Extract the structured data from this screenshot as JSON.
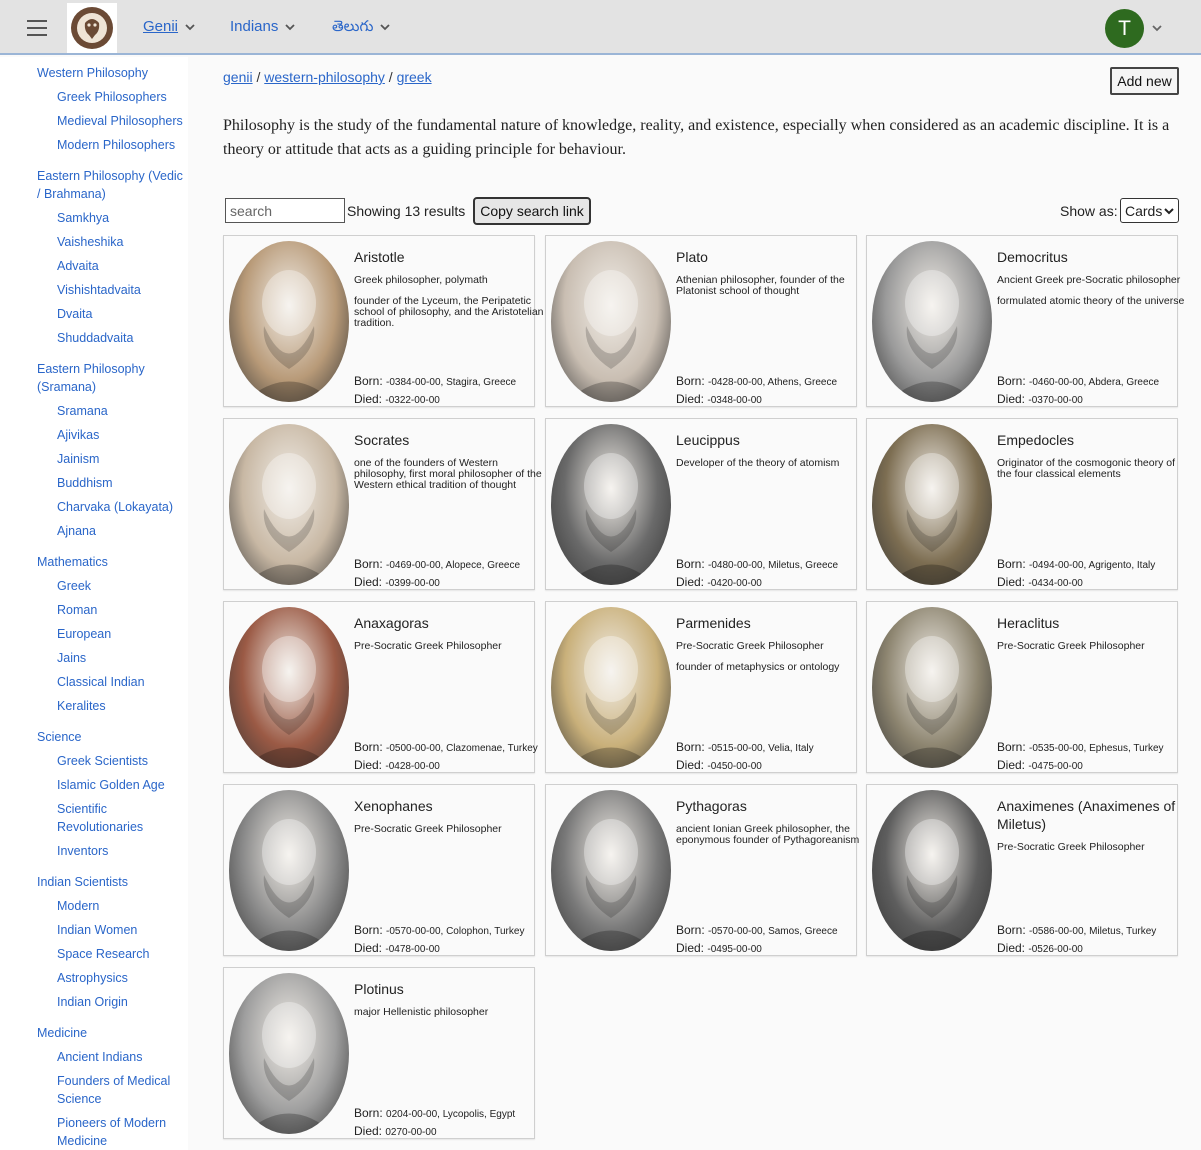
{
  "header": {
    "menus": [
      {
        "label": "Genii"
      },
      {
        "label": "Indians"
      },
      {
        "label": "తెలుగు"
      }
    ],
    "user_initial": "T"
  },
  "sidebar": {
    "groups": [
      {
        "label": "Western Philosophy",
        "items": [
          "Greek Philosophers",
          "Medieval Philosophers",
          "Modern Philosophers"
        ]
      },
      {
        "label": "Eastern Philosophy (Vedic / Brahmana)",
        "items": [
          "Samkhya",
          "Vaisheshika",
          "Advaita",
          "Vishishtadvaita",
          "Dvaita",
          "Shuddadvaita"
        ]
      },
      {
        "label": "Eastern Philosophy (Sramana)",
        "items": [
          "Sramana",
          "Ajivikas",
          "Jainism",
          "Buddhism",
          "Charvaka (Lokayata)",
          "Ajnana"
        ]
      },
      {
        "label": "Mathematics",
        "items": [
          "Greek",
          "Roman",
          "European",
          "Jains",
          "Classical Indian",
          "Keralites"
        ]
      },
      {
        "label": "Science",
        "items": [
          "Greek Scientists",
          "Islamic Golden Age",
          "Scientific Revolutionaries",
          "Inventors"
        ]
      },
      {
        "label": "Indian Scientists",
        "items": [
          "Modern",
          "Indian Women",
          "Space Research",
          "Astrophysics",
          "Indian Origin"
        ]
      },
      {
        "label": "Medicine",
        "items": [
          "Ancient Indians",
          "Founders of Medical Science",
          "Pioneers of Modern Medicine"
        ]
      }
    ]
  },
  "breadcrumb": {
    "root": "genii",
    "sep": "/",
    "parent": "western-philosophy",
    "current": "greek"
  },
  "add_new_label": "Add new",
  "description": "Philosophy is the study of the fundamental nature of knowledge, reality, and existence, especially when considered as an academic discipline. It is a theory or attitude that acts as a guiding principle for behaviour.",
  "search": {
    "placeholder": "search",
    "results_text": "Showing 13 results",
    "copy_label": "Copy search link"
  },
  "show_as": {
    "label": "Show as:",
    "selected": "Cards"
  },
  "born_label": "Born:",
  "died_label": "Died:",
  "cards": [
    {
      "name": "Aristotle",
      "desc": [
        "Greek philosopher, polymath",
        "founder of the Lyceum, the Peripatetic school of philosophy, and the Aristotelian tradition."
      ],
      "born": "-0384-00-00, Stagira, Greece",
      "died": "-0322-00-00",
      "tone": "#b89a78"
    },
    {
      "name": "Plato",
      "desc": [
        "Athenian philosopher, founder of the Platonist school of thought"
      ],
      "born": "-0428-00-00, Athens, Greece",
      "died": "-0348-00-00",
      "tone": "#c9beb2"
    },
    {
      "name": "Democritus",
      "desc": [
        "Ancient Greek pre-Socratic philosopher",
        "formulated atomic theory of the universe"
      ],
      "born": "-0460-00-00, Abdera, Greece",
      "died": "-0370-00-00",
      "tone": "#9a9a9a"
    },
    {
      "name": "Socrates",
      "desc": [
        "one of the founders of Western philosophy, first moral philosopher of the Western ethical tradition of thought"
      ],
      "born": "-0469-00-00, Alopece, Greece",
      "died": "-0399-00-00",
      "tone": "#c8b8a4"
    },
    {
      "name": "Leucippus",
      "desc": [
        "Developer of the theory of atomism"
      ],
      "born": "-0480-00-00, Miletus, Greece",
      "died": "-0420-00-00",
      "tone": "#6a6a6a"
    },
    {
      "name": "Empedocles",
      "desc": [
        "Originator of the cosmogonic theory of the four classical elements"
      ],
      "born": "-0494-00-00, Agrigento, Italy",
      "died": "-0434-00-00",
      "tone": "#7d6e52"
    },
    {
      "name": "Anaxagoras",
      "desc": [
        "Pre-Socratic Greek Philosopher"
      ],
      "born": "-0500-00-00, Clazomenae, Turkey",
      "died": "-0428-00-00",
      "tone": "#9b5a45"
    },
    {
      "name": "Parmenides",
      "desc": [
        "Pre-Socratic Greek Philosopher",
        "founder of metaphysics or ontology"
      ],
      "born": "-0515-00-00, Velia, Italy",
      "died": "-0450-00-00",
      "tone": "#c9b07a"
    },
    {
      "name": "Heraclitus",
      "desc": [
        "Pre-Socratic Greek Philosopher"
      ],
      "born": "-0535-00-00, Ephesus, Turkey",
      "died": "-0475-00-00",
      "tone": "#8d8570"
    },
    {
      "name": "Xenophanes",
      "desc": [
        "Pre-Socratic Greek Philosopher"
      ],
      "born": "-0570-00-00, Colophon, Turkey",
      "died": "-0478-00-00",
      "tone": "#8a8a8a"
    },
    {
      "name": "Pythagoras",
      "desc": [
        "ancient Ionian Greek philosopher, the eponymous founder of Pythagoreanism"
      ],
      "born": "-0570-00-00, Samos, Greece",
      "died": "-0495-00-00",
      "tone": "#7a7a7a"
    },
    {
      "name": "Anaximenes (Anaximenes of Miletus)",
      "desc": [
        "Pre-Socratic Greek Philosopher"
      ],
      "born": "-0586-00-00, Miletus, Turkey",
      "died": "-0526-00-00",
      "tone": "#5e5e5e"
    },
    {
      "name": "Plotinus",
      "desc": [
        "major Hellenistic philosopher"
      ],
      "born": "0204-00-00, Lycopolis, Egypt",
      "died": "0270-00-00",
      "tone": "#9e9e9e"
    }
  ]
}
